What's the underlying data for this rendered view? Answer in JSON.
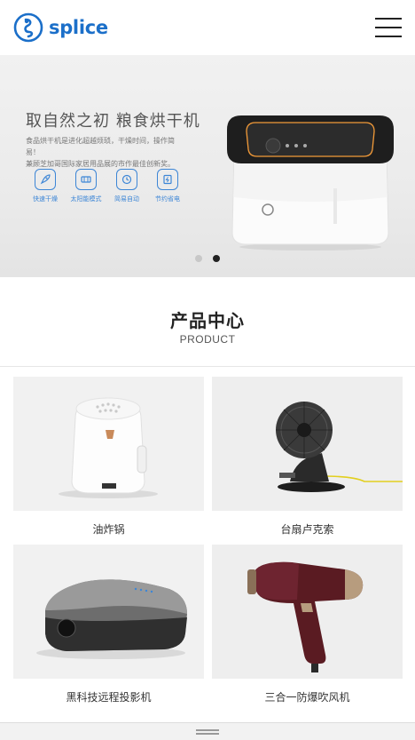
{
  "header": {
    "logo_text": "splice",
    "brand_color": "#1b6fc9",
    "menu_icon": "hamburger-menu-icon"
  },
  "banner": {
    "title": "取自然之初  粮食烘干机",
    "description_lines": [
      "食品烘干机是进化超越烦琐，干燥时间，操作简易！",
      "兼顾芝加哥国际家居用品展的市作最佳创新奖。"
    ],
    "features": [
      {
        "icon": "rocket-icon",
        "label": "快速干燥"
      },
      {
        "icon": "solar-icon",
        "label": "太阳能模式"
      },
      {
        "icon": "auto-icon",
        "label": "简易自动"
      },
      {
        "icon": "power-saving-icon",
        "label": "节约省电"
      }
    ],
    "slide_count": 2,
    "active_slide": 2,
    "accent_color": "#3d86d6"
  },
  "products_section": {
    "title": "产品中心",
    "subtitle": "PRODUCT"
  },
  "products": [
    {
      "name": "油炸锅",
      "image": "air-fryer-image"
    },
    {
      "name": "台扇卢克索",
      "image": "desk-fan-image"
    },
    {
      "name": "黑科技远程投影机",
      "image": "projector-image"
    },
    {
      "name": "三合一防爆吹风机",
      "image": "hair-dryer-image"
    }
  ]
}
